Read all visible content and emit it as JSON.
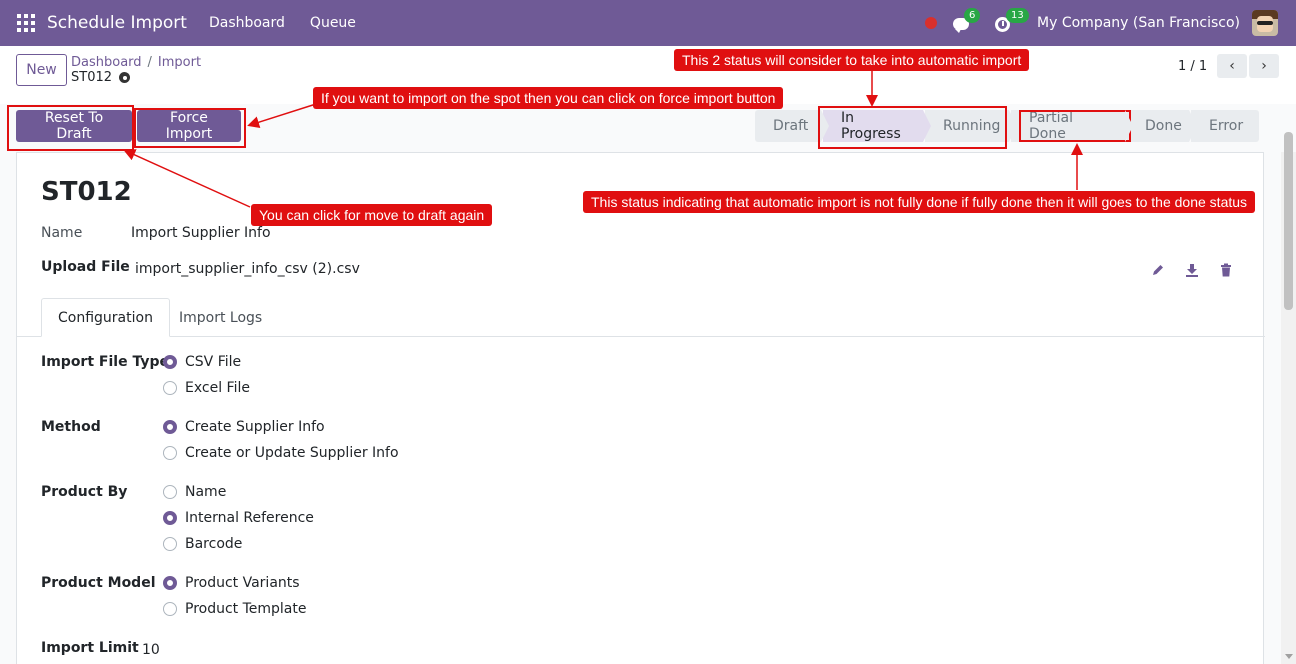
{
  "navbar": {
    "app_name": "Schedule Import",
    "menus": [
      "Dashboard",
      "Queue"
    ],
    "messages_count": "6",
    "activities_count": "13",
    "company": "My Company (San Francisco)"
  },
  "control": {
    "new_label": "New",
    "breadcrumb": [
      "Dashboard",
      "Import"
    ],
    "record_name": "ST012",
    "pager": "1 / 1"
  },
  "actions": {
    "reset_label": "Reset To Draft",
    "force_label": "Force Import"
  },
  "statusbar": [
    "Draft",
    "In Progress",
    "Running",
    "Partial Done",
    "Done",
    "Error"
  ],
  "form": {
    "title": "ST012",
    "name_label": "Name",
    "name_value": "Import Supplier Info",
    "upload_label": "Upload File",
    "upload_value": "import_supplier_info_csv (2).csv",
    "tabs": [
      "Configuration",
      "Import Logs"
    ],
    "file_type_label": "Import File Type",
    "file_type_options": [
      "CSV File",
      "Excel File"
    ],
    "method_label": "Method",
    "method_options": [
      "Create Supplier Info",
      "Create or Update Supplier Info"
    ],
    "product_by_label": "Product By",
    "product_by_options": [
      "Name",
      "Internal Reference",
      "Barcode"
    ],
    "product_model_label": "Product Model",
    "product_model_options": [
      "Product Variants",
      "Product Template"
    ],
    "import_limit_label": "Import Limit",
    "import_limit_value": "10"
  },
  "annotations": {
    "status_note": "This 2 status will consider to take into automatic import",
    "force_note": "If you want to import on the spot then you can click on force import button",
    "draft_note": "You can click for move to draft again",
    "partial_note": "This status indicating that automatic import is not fully done if fully done then it will goes to the done status"
  },
  "colors": {
    "brand": "#6f5a96",
    "annotation": "#e00f10"
  }
}
